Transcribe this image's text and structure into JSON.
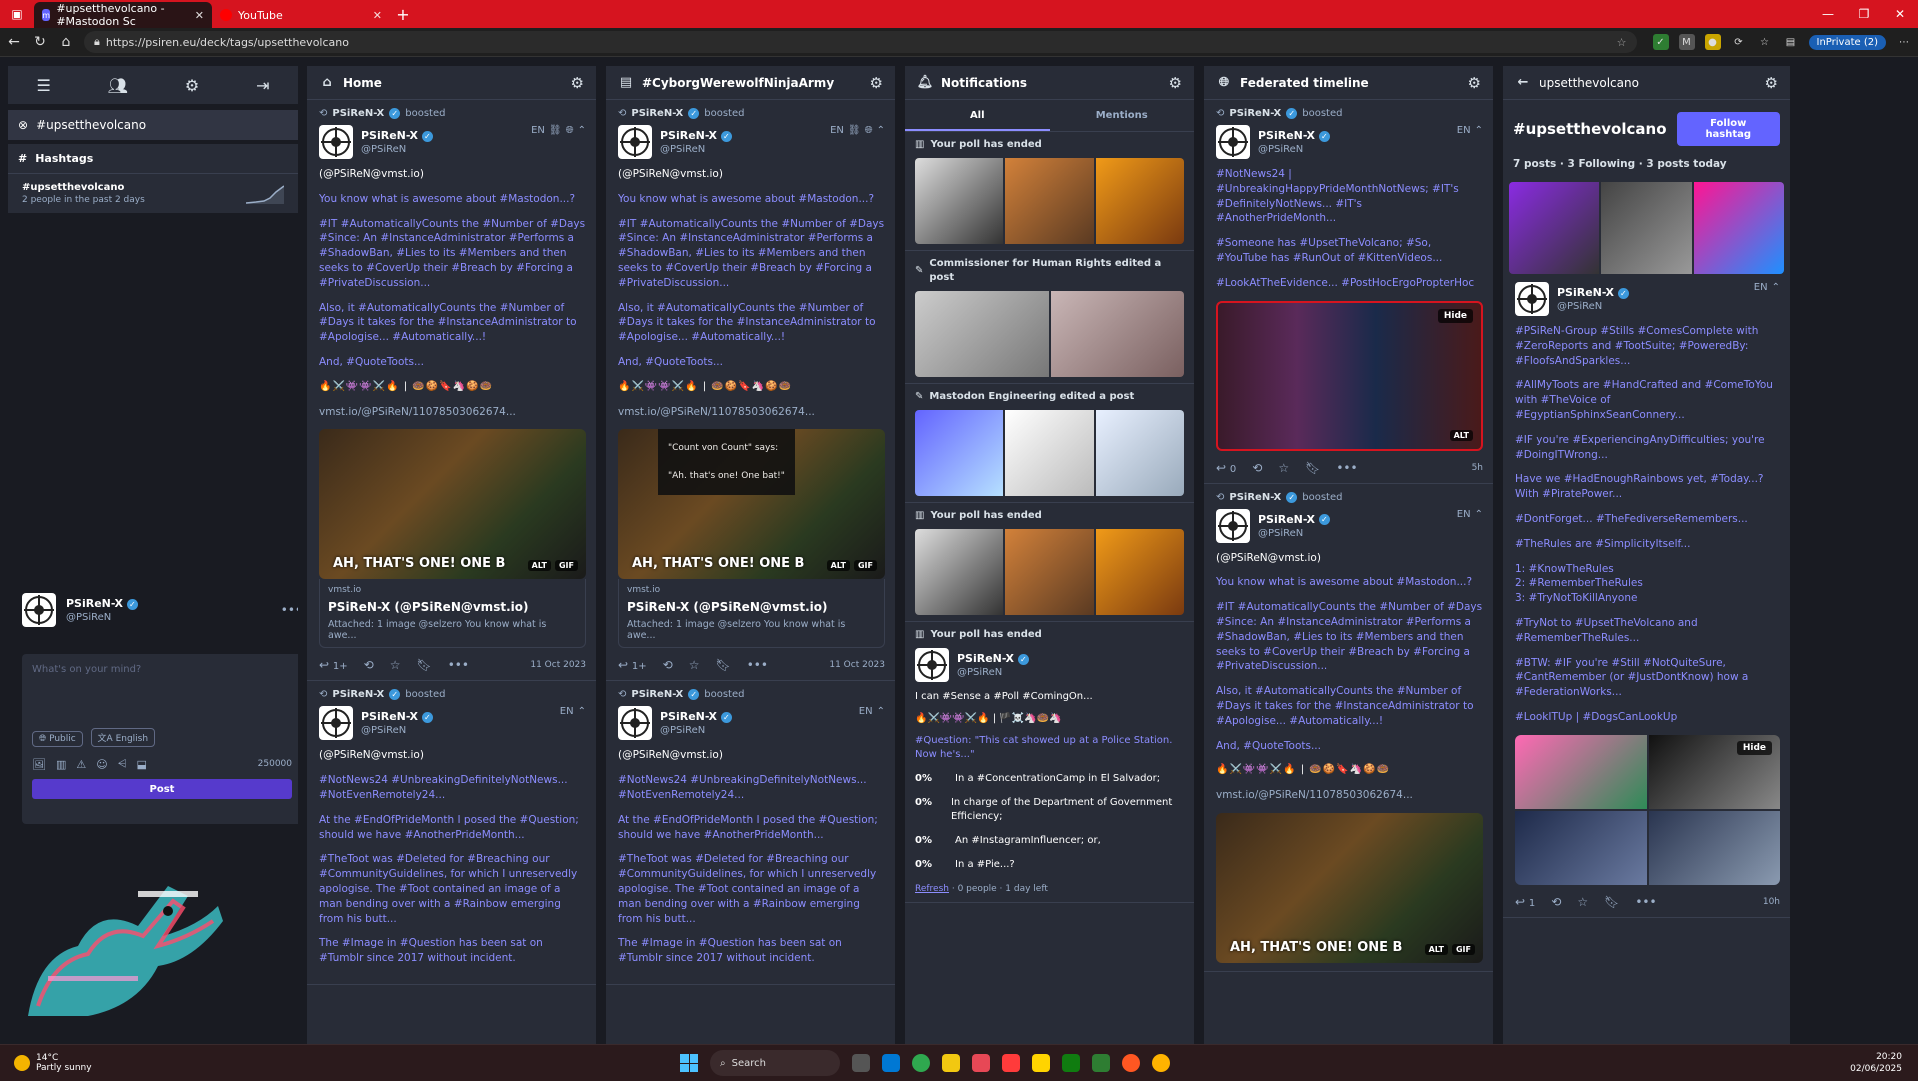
{
  "browser": {
    "tabs": [
      {
        "title": "#upsetthevolcano - #Mastodon Sc"
      },
      {
        "title": "YouTube"
      }
    ],
    "url": "https://psiren.eu/deck/tags/upsetthevolcano",
    "inprivate": "InPrivate (2)"
  },
  "sidebar": {
    "active_tag": "#upsetthevolcano",
    "hashtags_heading": "Hashtags",
    "trend_name": "#upsetthevolcano",
    "trend_sub": "2 people in the past 2 days",
    "user_name": "PSiReN-X",
    "user_handle": "@PSiReN",
    "compose_placeholder": "What's on your mind?",
    "visibility": "Public",
    "language": "English",
    "char_count": "250000",
    "post_label": "Post"
  },
  "columns": {
    "home": "Home",
    "cyborg": "#CyborgWerewolfNinjaArmy",
    "notifications": "Notifications",
    "federated": "Federated timeline",
    "hashtag": "upsetthevolcano"
  },
  "post1": {
    "boosted_by": "PSiReN-X",
    "boosted": "boosted",
    "name": "PSiReN-X",
    "handle": "@PSiReN",
    "lang": "EN",
    "p1": "(@PSiReN@vmst.io)",
    "p2": "You know what is awesome about #Mastodon...?",
    "p3": "#IT #AutomaticallyCounts the #Number of #Days #Since: An #InstanceAdministrator #Performs a #ShadowBan, #Lies to its #Members and then seeks to #CoverUp their #Breach by #Forcing a #PrivateDiscussion...",
    "p4": "Also, it #AutomaticallyCounts the #Number of #Days it takes for the #InstanceAdministrator to #Apologise... #Automatically...!",
    "p5": "And, #QuoteToots...",
    "emoji": "🔥⚔️👾👾⚔️🔥 | 🍩🍪🔖🦄🍪🍩",
    "link": "vmst.io/@PSiReN/11078503062674...",
    "caption": "AH, THAT'S ONE! ONE B",
    "bubble1": "\"Count von Count\" says:",
    "bubble2": "\"Ah. that's one! One bat!\"",
    "card_host": "vmst.io",
    "card_title": "PSiReN-X (@PSiReN@vmst.io)",
    "card_desc": "Attached: 1 image @selzero You know what is awe...",
    "reblogs": "1+",
    "date": "11 Oct 2023"
  },
  "post2": {
    "boosted_by": "PSiReN-X",
    "boosted": "boosted",
    "name": "PSiReN-X",
    "handle": "@PSiReN",
    "lang": "EN",
    "p1": "(@PSiReN@vmst.io)",
    "p2": "#NotNews24 #UnbreakingDefinitelyNotNews... #NotEvenRemotely24...",
    "p3": "At the #EndOfPrideMonth I posed the #Question; should we have #AnotherPrideMonth...",
    "p4": "#TheToot was #Deleted for #Breaching our #CommunityGuidelines, for which I unreservedly apologise. The #Toot contained an image of a man bending over with a #Rainbow emerging from his butt...",
    "p5": "The #Image in #Question has been sat on #Tumblr since 2017 without incident."
  },
  "notifications": {
    "tab_all": "All",
    "tab_mentions": "Mentions",
    "n1": "Your poll has ended",
    "n2": "Commissioner for Human Rights edited a post",
    "n3": "Mastodon Engineering edited a post",
    "n4": "Your poll has ended",
    "n5": "Your poll has ended",
    "poll_name": "PSiReN-X",
    "poll_handle": "@PSiReN",
    "poll_text": "I can #Sense a #Poll #ComingOn...",
    "poll_emoji": "🔥⚔️👾👾⚔️🔥 | 🏴☠️🦄🍩🦄",
    "poll_question": "#Question: \"This cat showed up at a Police Station. Now he's...\"",
    "options": [
      {
        "pct": "0%",
        "label": "In a #ConcentrationCamp in El Salvador;"
      },
      {
        "pct": "0%",
        "label": "In charge of the Department of Government Efficiency;"
      },
      {
        "pct": "0%",
        "label": "An #InstagramInfluencer; or,"
      },
      {
        "pct": "0%",
        "label": "In a #Pie...?"
      }
    ],
    "refresh": "Refresh",
    "poll_footer": "· 0 people · 1 day left"
  },
  "federated": {
    "boosted_by": "PSiReN-X",
    "boosted": "boosted",
    "name": "PSiReN-X",
    "handle": "@PSiReN",
    "lang": "EN",
    "p1": "#NotNews24 | #UnbreakingHappyPrideMonthNotNews; #IT's #DefinitelyNotNews... #IT's #AnotherPrideMonth...",
    "p2": "#Someone has #UpsetTheVolcano; #So, #YouTube has #RunOut of #KittenVideos...",
    "p3": "#LookAtTheEvidence... #PostHocErgoPropterHoc",
    "hide": "Hide",
    "replies": "0",
    "time": "5h"
  },
  "hashtag": {
    "title": "#upsetthevolcano",
    "follow": "Follow hashtag",
    "stats": "7 posts · 3 Following · 3 posts today",
    "name": "PSiReN-X",
    "handle": "@PSiReN",
    "lang": "EN",
    "p1": "#PSiReN-Group #Stills #ComesComplete with #ZeroReports and #TootSuite; #PoweredBy: #FloofsAndSparkles...",
    "p2": "#AllMyToots are #HandCrafted and #ComeToYou with #TheVoice of #EgyptianSphinxSeanConnery...",
    "p3": "#IF you're #ExperiencingAnyDifficulties; you're #DoingITWrong...",
    "p4": "Have we #HadEnoughRainbows yet, #Today...? With #PiratePower...",
    "p5": "#DontForget... #TheFediverseRemembers...",
    "p6": "#TheRules are #SimplicityItself...",
    "p7": "1: #KnowTheRules\n2: #RememberTheRules\n3: #TryNotToKillAnyone",
    "p8": "#TryNot to #UpsetTheVolcano and #RememberTheRules...",
    "p9": "#BTW: #IF you're #Still #NotQuiteSure, #CantRemember (or #JustDontKnow) how a #FederationWorks...",
    "p10": "#LookITUp | #DogsCanLookUp",
    "hide": "Hide",
    "replies": "1",
    "time": "10h"
  },
  "taskbar": {
    "temp": "14°C",
    "weather": "Partly sunny",
    "search": "Search",
    "time": "20:20",
    "date": "02/06/2025"
  },
  "colors": {
    "accent": "#6364ff",
    "panel": "#282c37",
    "bg": "#191b22",
    "link": "#8c8dff",
    "tabbar": "#d6141f"
  }
}
